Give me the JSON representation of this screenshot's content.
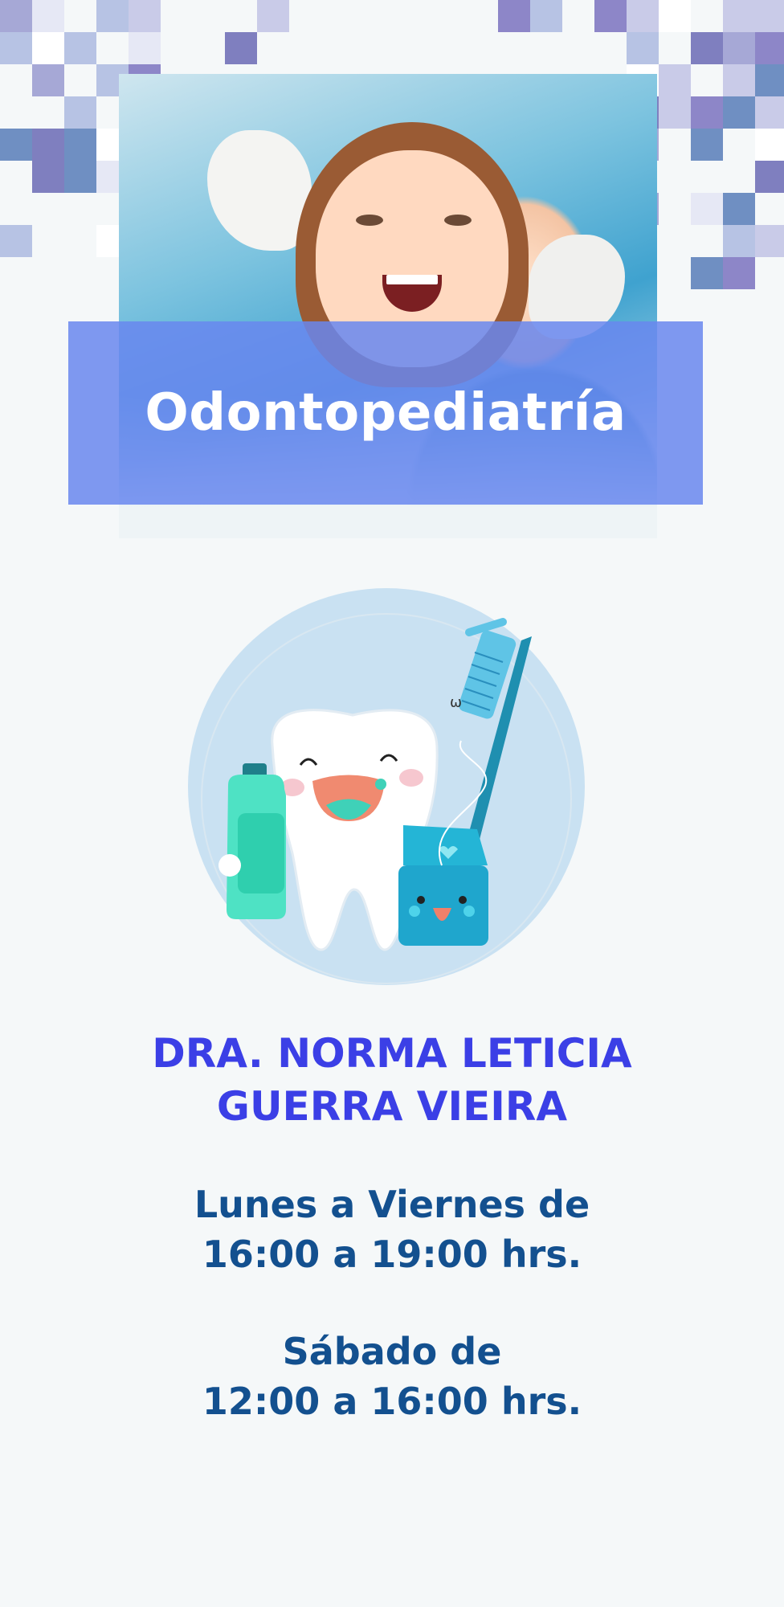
{
  "banner": {
    "title": "Odontopediatría",
    "photo_subject": "child-dental-exam-photo"
  },
  "doctor": {
    "name_line1": "DRA. NORMA LETICIA",
    "name_line2": "GUERRA VIEIRA"
  },
  "schedule": {
    "weekday_line1": "Lunes a Viernes de",
    "weekday_line2": "16:00 a 19:00 hrs.",
    "saturday_line1": "Sábado de",
    "saturday_line2": "12:00 a 16:00 hrs."
  },
  "colors": {
    "background": "#f5f8f9",
    "band": "#6887ee",
    "doctor_text": "#3b3fe6",
    "schedule_text": "#13508f",
    "illustration_circle": "#c9e1f2"
  }
}
